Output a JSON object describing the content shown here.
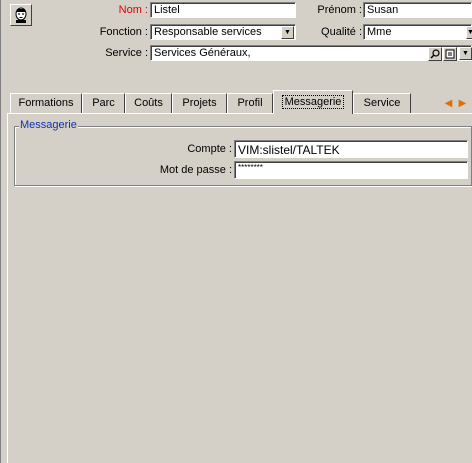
{
  "header": {
    "nom_label": "Nom :",
    "nom_value": "Listel",
    "prenom_label": "Prénom :",
    "prenom_value": "Susan",
    "fonction_label": "Fonction :",
    "fonction_value": "Responsable services",
    "qualite_label": "Qualité :",
    "qualite_value": "Mme",
    "service_label": "Service :",
    "service_value": "Services Généraux,"
  },
  "tabs": [
    {
      "label": "Formations"
    },
    {
      "label": "Parc"
    },
    {
      "label": "Coûts"
    },
    {
      "label": "Projets"
    },
    {
      "label": "Profil"
    },
    {
      "label": "Messagerie"
    },
    {
      "label": "Service"
    }
  ],
  "active_tab": "Messagerie",
  "messagerie": {
    "group_title": "Messagerie",
    "compte_label": "Compte :",
    "compte_value": "VIM:slistel/TALTEK",
    "password_label": "Mot de passe :",
    "password_value": "********"
  },
  "icons": {
    "avatar": "person-icon",
    "dropdown": "chevron-down-icon",
    "search": "magnifier-icon",
    "detail": "detail-icon",
    "tab_prev": "arrow-left-icon",
    "tab_next": "arrow-right-icon"
  },
  "colors": {
    "background": "#d4d0c8",
    "required_label": "#e00000",
    "group_title": "#1030b0",
    "tab_arrow": "#e07000"
  }
}
